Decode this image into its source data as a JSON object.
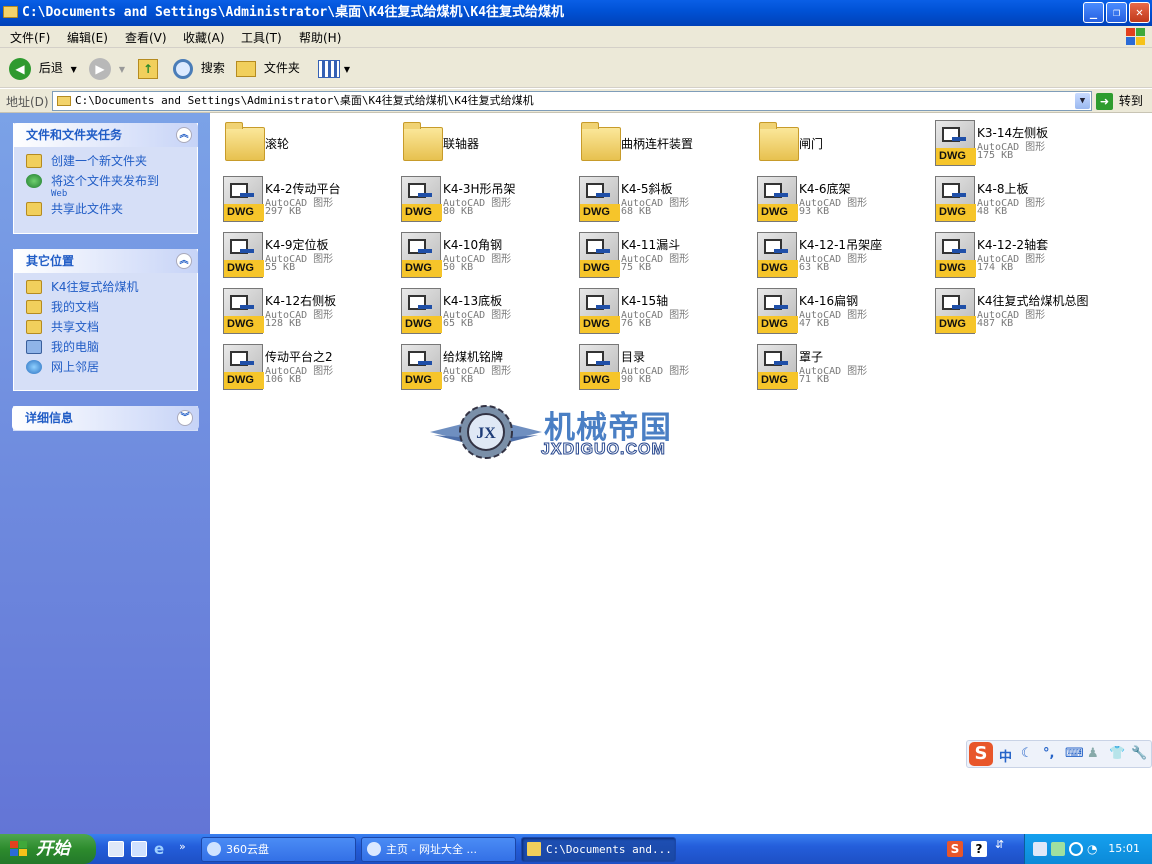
{
  "window": {
    "title": "C:\\Documents and Settings\\Administrator\\桌面\\K4往复式给煤机\\K4往复式给煤机",
    "buttons": [
      "minimize",
      "maximize",
      "close"
    ]
  },
  "menubar": {
    "items": [
      "文件(F)",
      "编辑(E)",
      "查看(V)",
      "收藏(A)",
      "工具(T)",
      "帮助(H)"
    ]
  },
  "toolbar": {
    "back_label": "后退",
    "search_label": "搜索",
    "folders_label": "文件夹"
  },
  "address": {
    "label": "地址(D)",
    "value": "C:\\Documents and Settings\\Administrator\\桌面\\K4往复式给煤机\\K4往复式给煤机",
    "go_label": "转到"
  },
  "sidebar": {
    "tasks": {
      "title": "文件和文件夹任务",
      "items": [
        "创建一个新文件夹",
        "将这个文件夹发布到",
        "Web",
        "共享此文件夹"
      ]
    },
    "places": {
      "title": "其它位置",
      "items": [
        "K4往复式给煤机",
        "我的文档",
        "共享文档",
        "我的电脑",
        "网上邻居"
      ]
    },
    "details": {
      "title": "详细信息"
    }
  },
  "files": {
    "type_label": "AutoCAD 图形",
    "dwg_tag": "DWG",
    "items": [
      {
        "name": "滚轮",
        "kind": "folder"
      },
      {
        "name": "联轴器",
        "kind": "folder"
      },
      {
        "name": "曲柄连杆装置",
        "kind": "folder"
      },
      {
        "name": "闸门",
        "kind": "folder"
      },
      {
        "name": "K3-14左侧板",
        "kind": "dwg",
        "size": "175 KB"
      },
      {
        "name": "K4-2传动平台",
        "kind": "dwg",
        "size": "297 KB"
      },
      {
        "name": "K4-3H形吊架",
        "kind": "dwg",
        "size": "80 KB"
      },
      {
        "name": "K4-5斜板",
        "kind": "dwg",
        "size": "68 KB"
      },
      {
        "name": "K4-6底架",
        "kind": "dwg",
        "size": "93 KB"
      },
      {
        "name": "K4-8上板",
        "kind": "dwg",
        "size": "48 KB"
      },
      {
        "name": "K4-9定位板",
        "kind": "dwg",
        "size": "55 KB"
      },
      {
        "name": "K4-10角钢",
        "kind": "dwg",
        "size": "50 KB"
      },
      {
        "name": "K4-11漏斗",
        "kind": "dwg",
        "size": "75 KB"
      },
      {
        "name": "K4-12-1吊架座",
        "kind": "dwg",
        "size": "63 KB"
      },
      {
        "name": "K4-12-2轴套",
        "kind": "dwg",
        "size": "174 KB"
      },
      {
        "name": "K4-12右侧板",
        "kind": "dwg",
        "size": "128 KB"
      },
      {
        "name": "K4-13底板",
        "kind": "dwg",
        "size": "65 KB"
      },
      {
        "name": "K4-15轴",
        "kind": "dwg",
        "size": "76 KB"
      },
      {
        "name": "K4-16扁钢",
        "kind": "dwg",
        "size": "47 KB"
      },
      {
        "name": "K4往复式给煤机总图",
        "kind": "dwg",
        "size": "487 KB"
      },
      {
        "name": "传动平台之2",
        "kind": "dwg",
        "size": "106 KB"
      },
      {
        "name": "给煤机铭牌",
        "kind": "dwg",
        "size": "69 KB"
      },
      {
        "name": "目录",
        "kind": "dwg",
        "size": "90 KB"
      },
      {
        "name": "罩子",
        "kind": "dwg",
        "size": "71 KB"
      }
    ]
  },
  "watermark": {
    "text": "机械帝国",
    "url": "JXDIGUO.COM",
    "emblem": "JX"
  },
  "ime": {
    "logo": "S",
    "mode": "中"
  },
  "taskbar": {
    "start_label": "开始",
    "tasks": [
      "360云盘",
      "主页 - 网址大全 ...",
      "C:\\Documents and..."
    ],
    "clock": "15:01"
  }
}
